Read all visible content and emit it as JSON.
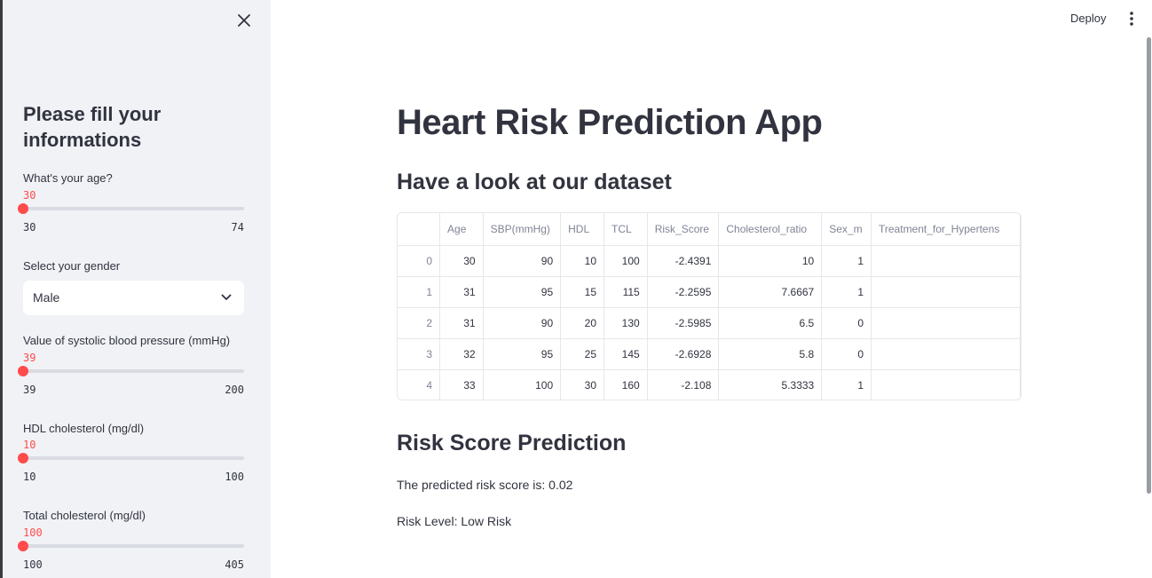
{
  "sidebar": {
    "title": "Please fill your informations",
    "sliders": [
      {
        "label": "What's your age?",
        "value": "30",
        "min": "30",
        "max": "74"
      },
      {
        "label": "Value of systolic blood pressure (mmHg)",
        "value": "39",
        "min": "39",
        "max": "200"
      },
      {
        "label": "HDL cholesterol (mg/dl)",
        "value": "10",
        "min": "10",
        "max": "100"
      },
      {
        "label": "Total cholesterol (mg/dl)",
        "value": "100",
        "min": "100",
        "max": "405"
      }
    ],
    "gender": {
      "label": "Select your gender",
      "value": "Male"
    }
  },
  "topbar": {
    "deploy_label": "Deploy"
  },
  "main": {
    "title": "Heart Risk Prediction App",
    "dataset_heading": "Have a look at our dataset",
    "prediction_heading": "Risk Score Prediction",
    "predicted_text": "The predicted risk score is: 0.02",
    "risk_level_text": "Risk Level: Low Risk"
  },
  "table": {
    "columns": [
      "",
      "Age",
      "SBP(mmHg)",
      "HDL",
      "TCL",
      "Risk_Score",
      "Cholesterol_ratio",
      "Sex_m",
      "Treatment_for_Hypertens"
    ],
    "rows": [
      [
        "0",
        "30",
        "90",
        "10",
        "100",
        "-2.4391",
        "10",
        "1",
        ""
      ],
      [
        "1",
        "31",
        "95",
        "15",
        "115",
        "-2.2595",
        "7.6667",
        "1",
        ""
      ],
      [
        "2",
        "31",
        "90",
        "20",
        "130",
        "-2.5985",
        "6.5",
        "0",
        ""
      ],
      [
        "3",
        "32",
        "95",
        "25",
        "145",
        "-2.6928",
        "5.8",
        "0",
        ""
      ],
      [
        "4",
        "33",
        "100",
        "30",
        "160",
        "-2.108",
        "5.3333",
        "1",
        ""
      ]
    ]
  },
  "colors": {
    "accent": "#ff4b4b",
    "sidebar_bg": "#f0f2f6",
    "text": "#31333f"
  },
  "icons": {
    "close": "close-icon",
    "menu": "more-vertical-icon",
    "dropdown": "chevron-down-icon"
  }
}
